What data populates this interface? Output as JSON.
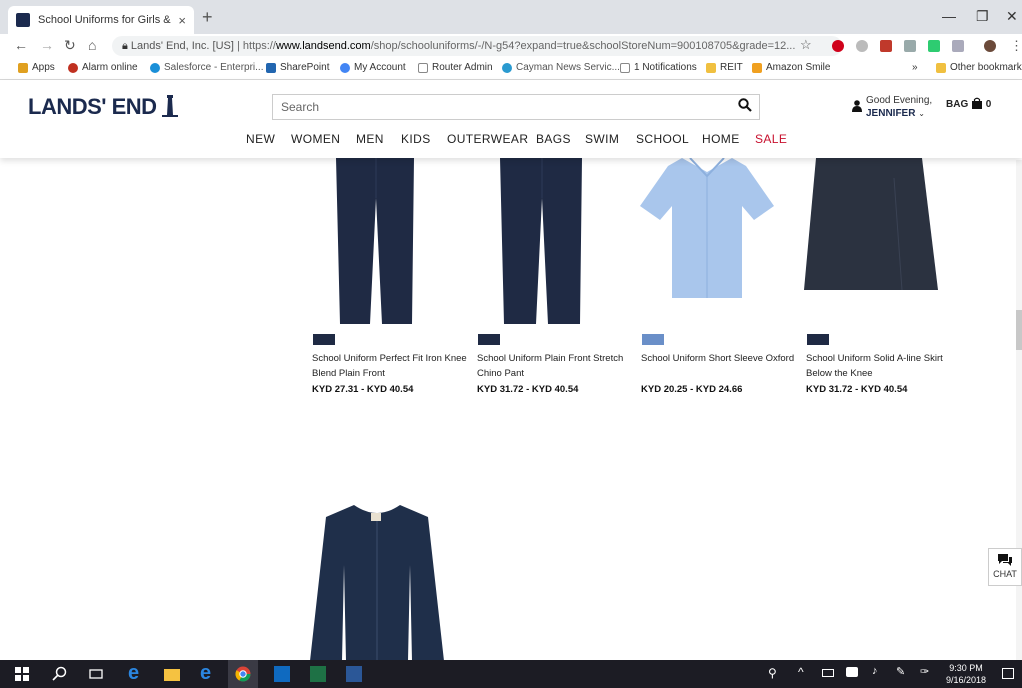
{
  "browser": {
    "tab_title": "School Uniforms for Girls & Boys",
    "tab_close": "×",
    "new_tab": "+",
    "url_secure": "Lands' End, Inc. [US]",
    "url_sep": "|",
    "url_scheme": "https://",
    "url_domain": "www.landsend.com",
    "url_path": "/shop/schooluniforms/-/N-g54?expand=true&schoolStoreNum=900108705&grade=12...",
    "window_controls": {
      "min": "—",
      "max": "❐",
      "close": "✕"
    }
  },
  "bookmarks": [
    {
      "label": "Apps",
      "color": "#e0a020"
    },
    {
      "label": "Alarm online",
      "color": "#c03020"
    },
    {
      "label": "Salesforce - Enterpri...",
      "color": "#1a8fd8"
    },
    {
      "label": "SharePoint",
      "color": "#2266b0"
    },
    {
      "label": "My Account",
      "color": "#4285f4"
    },
    {
      "label": "Router Admin",
      "color": "#888888"
    },
    {
      "label": "Cayman News Servic...",
      "color": "#2a9ad0"
    },
    {
      "label": "1 Notifications",
      "color": "#888888"
    },
    {
      "label": "REIT",
      "color": "#f0c040"
    },
    {
      "label": "Amazon Smile",
      "color": "#f0a020"
    },
    {
      "label": "»",
      "color": ""
    },
    {
      "label": "Other bookmarks",
      "color": "#f0c040"
    }
  ],
  "site": {
    "logo": "LANDS' END",
    "search_placeholder": "Search",
    "greeting_line1": "Good Evening,",
    "greeting_name": "JENNIFER",
    "bag_label": "BAG",
    "bag_count": "0",
    "nav": [
      "NEW",
      "WOMEN",
      "MEN",
      "KIDS",
      "OUTERWEAR",
      "BAGS",
      "SWIM",
      "SCHOOL",
      "HOME",
      "SALE"
    ],
    "sale_color": "#c8102e",
    "brand_color": "#1b2a4e"
  },
  "products": [
    {
      "title": "School Uniform Perfect Fit Iron Knee Blend Plain Front",
      "price": "KYD 27.31 - KYD 40.54",
      "swatch": "#1f2a44"
    },
    {
      "title": "School Uniform Plain Front Stretch Chino Pant",
      "price": "KYD 31.72 - KYD 40.54",
      "swatch": "#1f2a44"
    },
    {
      "title": "School Uniform Short Sleeve Oxford",
      "price": "KYD 20.25 - KYD 24.66",
      "swatch": "#6a8fc8"
    },
    {
      "title": "School Uniform Solid A-line Skirt Below the Knee",
      "price": "KYD 31.72 - KYD 40.54",
      "swatch": "#1f2a44"
    }
  ],
  "chat_label": "CHAT",
  "taskbar": {
    "time": "9:30 PM",
    "date": "9/16/2018"
  }
}
